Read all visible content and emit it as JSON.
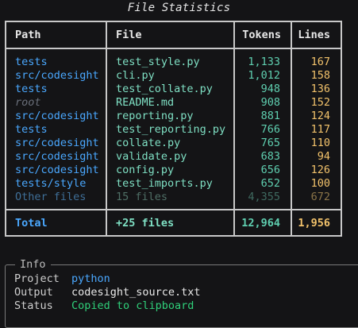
{
  "title": "File Statistics",
  "columns": {
    "path": "Path",
    "file": "File",
    "tokens": "Tokens",
    "lines": "Lines"
  },
  "rows": [
    {
      "path": "tests",
      "file": "test_style.py",
      "tokens": "1,133",
      "lines": "167",
      "style": "normal"
    },
    {
      "path": "src/codesight",
      "file": "cli.py",
      "tokens": "1,012",
      "lines": "158",
      "style": "normal"
    },
    {
      "path": "tests",
      "file": "test_collate.py",
      "tokens": "948",
      "lines": "136",
      "style": "normal"
    },
    {
      "path": "root",
      "file": "README.md",
      "tokens": "908",
      "lines": "152",
      "style": "root"
    },
    {
      "path": "src/codesight",
      "file": "reporting.py",
      "tokens": "881",
      "lines": "124",
      "style": "normal"
    },
    {
      "path": "tests",
      "file": "test_reporting.py",
      "tokens": "766",
      "lines": "117",
      "style": "normal"
    },
    {
      "path": "src/codesight",
      "file": "collate.py",
      "tokens": "765",
      "lines": "110",
      "style": "normal"
    },
    {
      "path": "src/codesight",
      "file": "validate.py",
      "tokens": "683",
      "lines": "94",
      "style": "normal"
    },
    {
      "path": "src/codesight",
      "file": "config.py",
      "tokens": "656",
      "lines": "126",
      "style": "normal"
    },
    {
      "path": "tests/style",
      "file": "test_imports.py",
      "tokens": "652",
      "lines": "100",
      "style": "normal"
    },
    {
      "path": "Other files",
      "file": "15 files",
      "tokens": "4,355",
      "lines": "672",
      "style": "dim"
    }
  ],
  "total": {
    "label": "Total",
    "files": "+25 files",
    "tokens": "12,964",
    "lines": "1,956"
  },
  "info": {
    "title": "Info",
    "project_label": "Project",
    "project_value": "python",
    "output_label": "Output",
    "output_value": "codesight_source.txt",
    "status_label": "Status",
    "status_value": "Copied to clipboard"
  }
}
